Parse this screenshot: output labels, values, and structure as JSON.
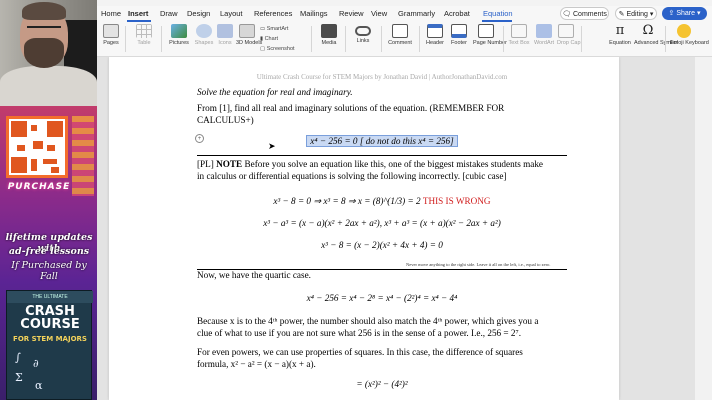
{
  "promo": {
    "purchase": "PURCHASE",
    "line1": "lifetime updates with",
    "line2": "ad-free lessons",
    "line3": "If Purchased by Fall",
    "book_top": "THE ULTIMATE",
    "book_title": "CRASH COURSE",
    "book_sub": "FOR STEM MAJORS"
  },
  "menu": {
    "tabs": [
      "Home",
      "Insert",
      "Draw",
      "Design",
      "Layout",
      "References",
      "Mailings",
      "Review",
      "View",
      "Grammarly",
      "Acrobat",
      "Equation"
    ],
    "active": "Insert",
    "comments": "Comments",
    "editing": "Editing",
    "share": "Share"
  },
  "ribbon": {
    "pages": "Pages",
    "table": "Table",
    "pictures": "Pictures",
    "shapes": "Shapes",
    "icons": "Icons",
    "models": "3D Models",
    "smartart": "SmartArt",
    "chart": "Chart",
    "screenshot": "Screenshot",
    "media": "Media",
    "links": "Links",
    "comment": "Comment",
    "header": "Header",
    "footer": "Footer",
    "page_number": "Page Number",
    "text_box": "Text Box",
    "wordart": "WordArt",
    "drop_cap": "Drop Cap",
    "equation": "Equation",
    "advanced_symbol": "Advanced Symbol",
    "emoji_keyboard": "Emoji Keyboard",
    "eq_symbol": "π",
    "omega_symbol": "Ω"
  },
  "doc": {
    "header": "Ultimate Crash Course for STEM Majors by Jonathan David | AuthorJonathanDavid.com",
    "l1": "Solve the equation for real and imaginary.",
    "l2": "From [1], find all real and imaginary solutions of the equation. (REMEMBER FOR",
    "l3": "CALCULUS+)",
    "eq_main": "x⁴ − 256 = 0   [ do not do this x⁴ = 256]",
    "pl_tag": "[PL] ",
    "note": "NOTE",
    "l4": " Before you solve an equation like this, one of the biggest mistakes students make",
    "l5": "in calculus or differential equations is solving the following incorrectly. [cubic case]",
    "eq_cubic": "x³ − 8 = 0   ⇒   x³ = 8   ⇒   x = (8)^(1/3) = 2  ",
    "wrong": "THIS IS WRONG",
    "eq_diff_cubes": "x³ − a³ = (x − a)(x² + 2ax + a²),        x³ + a³ = (x + a)(x² − 2ax + a²)",
    "eq_factor": "x³ − 8 = (x − 2)(x² + 4x + 4) = 0",
    "tiny_note": "Never move anything to the right side. Leave it all on the left, i.e., equal to zero.",
    "l6": "Now, we have the quartic case.",
    "eq_quartic": "x⁴ − 256 = x⁴ − 2⁸ = x⁴ − (2²)⁴ = x⁴ − 4⁴",
    "l7": "Because x is to the 4ᵗʰ power, the number should also match the 4ᵗʰ power, which gives you a",
    "l8": "clue of what to use if you are not sure what 256 is in the sense of a power. I.e., 256 = 2⁷.",
    "l9": "For even powers, we can use properties of squares. In this case, the difference of squares",
    "l10": "formula, x² − a² = (x − a)(x + a).",
    "eq_last": "= (x²)² − (4²)²"
  }
}
